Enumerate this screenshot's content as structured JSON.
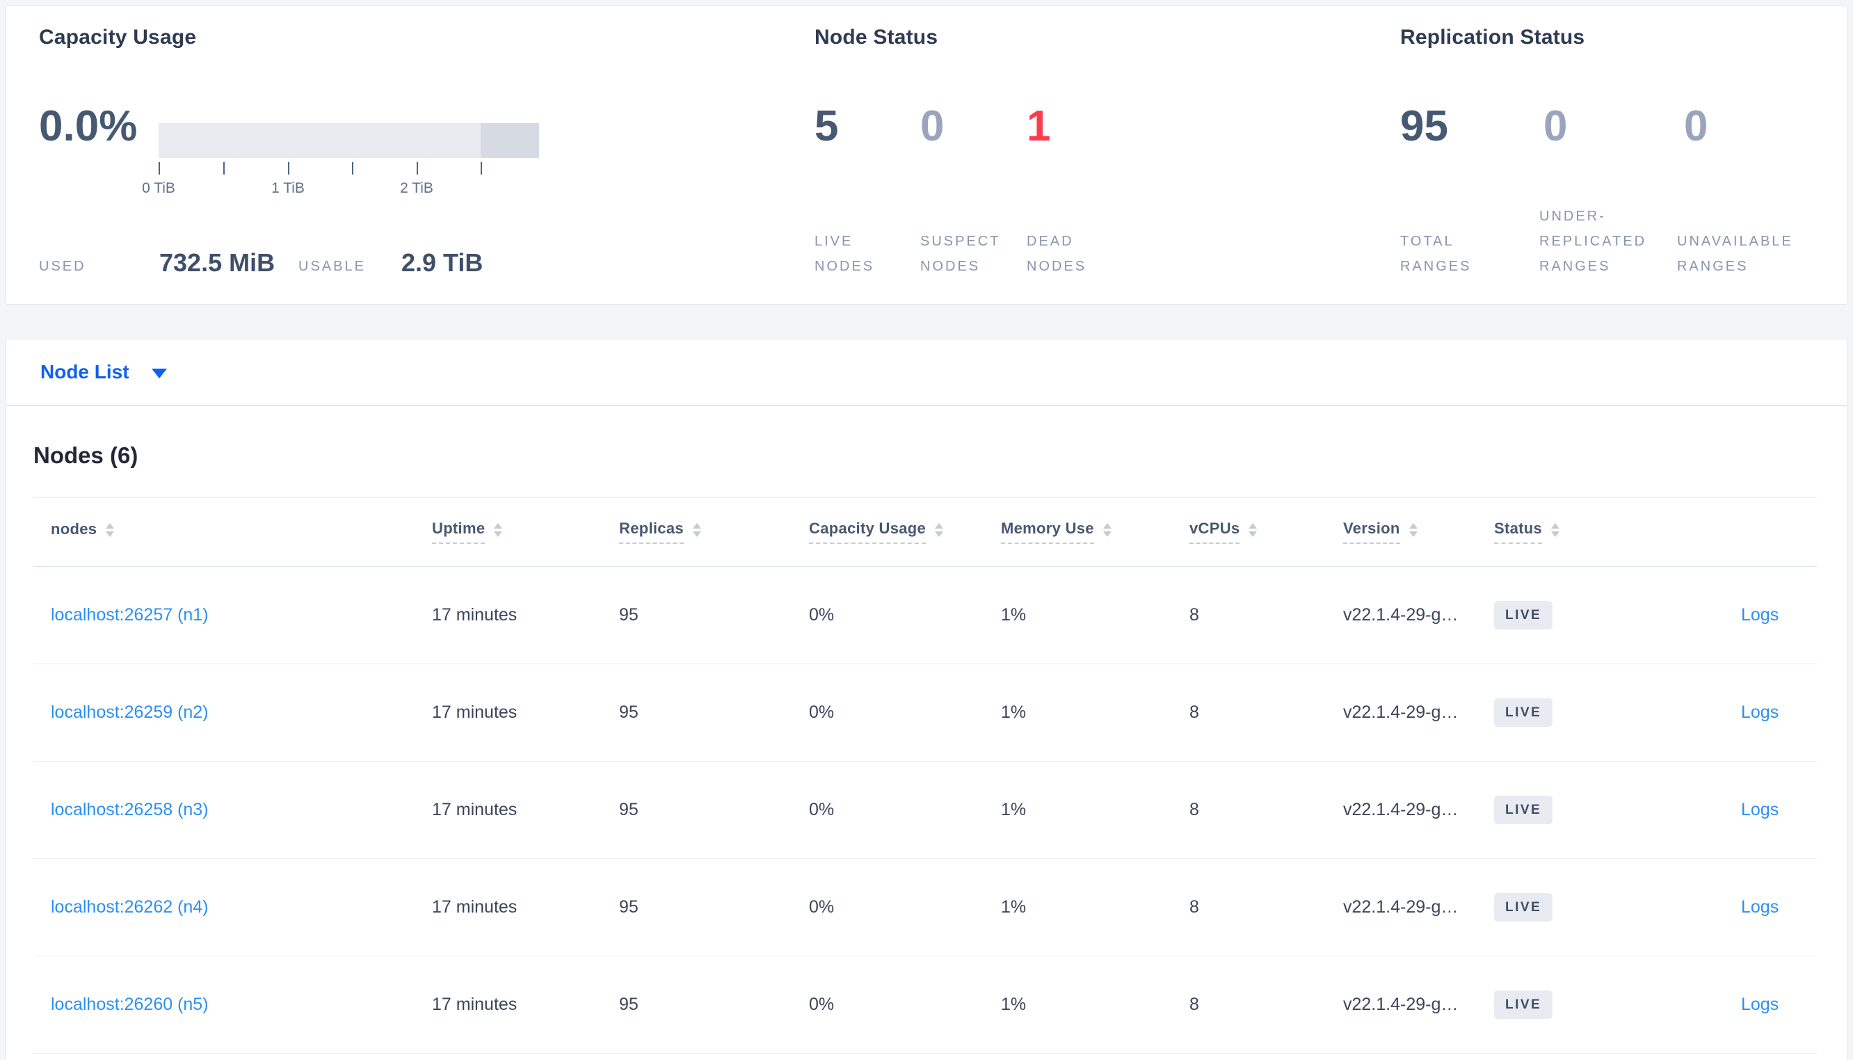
{
  "colors": {
    "accent_link": "#2b90f2",
    "node_list_blue": "#0f5ff0",
    "dead_node_red": "#fc3b4e",
    "dark_number": "#475872",
    "muted_number": "#9aa4bc",
    "badge_bg": "#e8ebf2",
    "page_bg": "#f4f5f9"
  },
  "capacity_usage": {
    "title": "Capacity Usage",
    "percent_used": "0.0%",
    "gauge": {
      "tick_labels": [
        "0 TiB",
        "1 TiB",
        "2 TiB"
      ]
    },
    "used": {
      "label": "USED",
      "value": "732.5 MiB"
    },
    "usable": {
      "label": "USABLE",
      "value": "2.9 TiB"
    }
  },
  "node_status": {
    "title": "Node Status",
    "live": {
      "value": "5",
      "lines": [
        "LIVE",
        "NODES"
      ]
    },
    "suspect": {
      "value": "0",
      "lines": [
        "SUSPECT",
        "NODES"
      ]
    },
    "dead": {
      "value": "1",
      "lines": [
        "DEAD",
        "NODES"
      ]
    }
  },
  "replication_status": {
    "title": "Replication Status",
    "total": {
      "value": "95",
      "lines": [
        "TOTAL",
        "RANGES"
      ]
    },
    "under_replicated": {
      "value": "0",
      "lines": [
        "UNDER-",
        "REPLICATED",
        "RANGES"
      ]
    },
    "unavailable": {
      "value": "0",
      "lines": [
        "UNAVAILABLE",
        "RANGES"
      ]
    }
  },
  "node_list_dropdown": {
    "label": "Node List"
  },
  "nodes_table": {
    "title": "Nodes (6)",
    "columns": [
      "nodes",
      "Uptime",
      "Replicas",
      "Capacity Usage",
      "Memory Use",
      "vCPUs",
      "Version",
      "Status"
    ],
    "rows": [
      {
        "address": "localhost:26257 (n1)",
        "uptime": "17 minutes",
        "replicas": "95",
        "capacity_usage": "0%",
        "memory_use": "1%",
        "vcpus": "8",
        "version": "v22.1.4-29-g…",
        "status": "LIVE",
        "logs": "Logs"
      },
      {
        "address": "localhost:26259 (n2)",
        "uptime": "17 minutes",
        "replicas": "95",
        "capacity_usage": "0%",
        "memory_use": "1%",
        "vcpus": "8",
        "version": "v22.1.4-29-g…",
        "status": "LIVE",
        "logs": "Logs"
      },
      {
        "address": "localhost:26258 (n3)",
        "uptime": "17 minutes",
        "replicas": "95",
        "capacity_usage": "0%",
        "memory_use": "1%",
        "vcpus": "8",
        "version": "v22.1.4-29-g…",
        "status": "LIVE",
        "logs": "Logs"
      },
      {
        "address": "localhost:26262 (n4)",
        "uptime": "17 minutes",
        "replicas": "95",
        "capacity_usage": "0%",
        "memory_use": "1%",
        "vcpus": "8",
        "version": "v22.1.4-29-g…",
        "status": "LIVE",
        "logs": "Logs"
      },
      {
        "address": "localhost:26260 (n5)",
        "uptime": "17 minutes",
        "replicas": "95",
        "capacity_usage": "0%",
        "memory_use": "1%",
        "vcpus": "8",
        "version": "v22.1.4-29-g…",
        "status": "LIVE",
        "logs": "Logs"
      }
    ]
  }
}
